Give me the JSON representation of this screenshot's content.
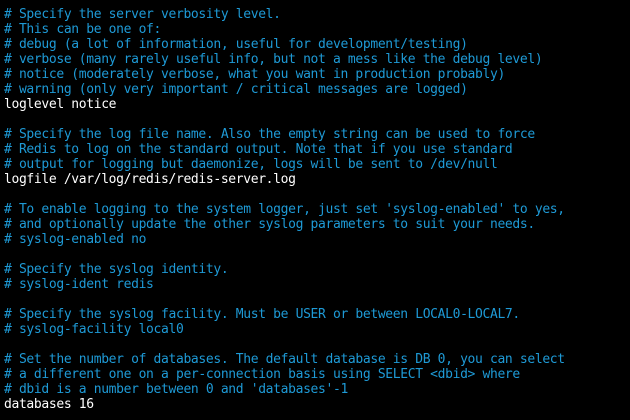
{
  "colors": {
    "background": "#000000",
    "comment": "#1e9ad6",
    "directive": "#ffffff"
  },
  "lines": [
    {
      "type": "comment",
      "text": "# Specify the server verbosity level."
    },
    {
      "type": "comment",
      "text": "# This can be one of:"
    },
    {
      "type": "comment",
      "text": "# debug (a lot of information, useful for development/testing)"
    },
    {
      "type": "comment",
      "text": "# verbose (many rarely useful info, but not a mess like the debug level)"
    },
    {
      "type": "comment",
      "text": "# notice (moderately verbose, what you want in production probably)"
    },
    {
      "type": "comment",
      "text": "# warning (only very important / critical messages are logged)"
    },
    {
      "type": "directive",
      "text": "loglevel notice"
    },
    {
      "type": "blank",
      "text": ""
    },
    {
      "type": "comment",
      "text": "# Specify the log file name. Also the empty string can be used to force"
    },
    {
      "type": "comment",
      "text": "# Redis to log on the standard output. Note that if you use standard"
    },
    {
      "type": "comment",
      "text": "# output for logging but daemonize, logs will be sent to /dev/null"
    },
    {
      "type": "directive",
      "text": "logfile /var/log/redis/redis-server.log"
    },
    {
      "type": "blank",
      "text": ""
    },
    {
      "type": "comment",
      "text": "# To enable logging to the system logger, just set 'syslog-enabled' to yes,"
    },
    {
      "type": "comment",
      "text": "# and optionally update the other syslog parameters to suit your needs."
    },
    {
      "type": "comment",
      "text": "# syslog-enabled no"
    },
    {
      "type": "blank",
      "text": ""
    },
    {
      "type": "comment",
      "text": "# Specify the syslog identity."
    },
    {
      "type": "comment",
      "text": "# syslog-ident redis"
    },
    {
      "type": "blank",
      "text": ""
    },
    {
      "type": "comment",
      "text": "# Specify the syslog facility. Must be USER or between LOCAL0-LOCAL7."
    },
    {
      "type": "comment",
      "text": "# syslog-facility local0"
    },
    {
      "type": "blank",
      "text": ""
    },
    {
      "type": "comment",
      "text": "# Set the number of databases. The default database is DB 0, you can select"
    },
    {
      "type": "comment",
      "text": "# a different one on a per-connection basis using SELECT <dbid> where"
    },
    {
      "type": "comment",
      "text": "# dbid is a number between 0 and 'databases'-1"
    },
    {
      "type": "directive",
      "text": "databases 16"
    }
  ]
}
